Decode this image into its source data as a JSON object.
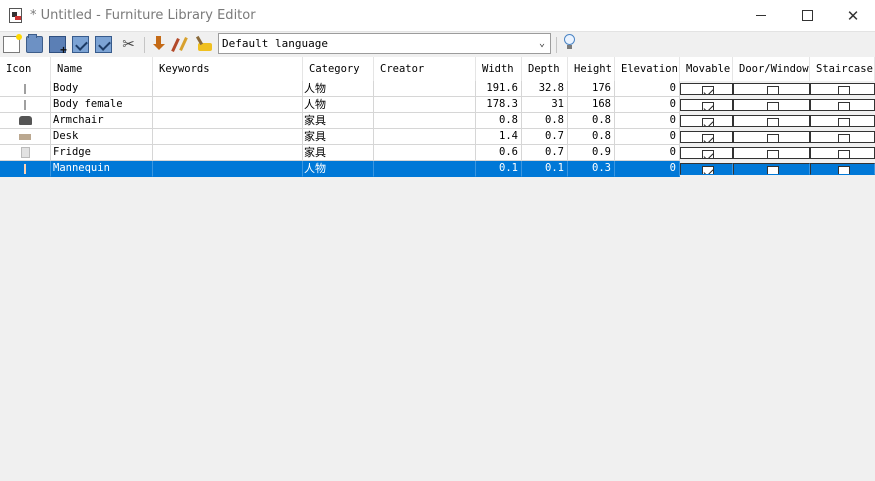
{
  "window": {
    "title": "* Untitled - Furniture Library Editor"
  },
  "toolbar": {
    "buttons": [
      "new-library",
      "open-library",
      "merge-library",
      "save-library",
      "save-as-library",
      "preferences",
      "import-furniture",
      "modify-furniture",
      "delete-furniture",
      "help"
    ],
    "language": "Default language"
  },
  "table": {
    "columns": [
      "Icon",
      "Name",
      "Keywords",
      "Category",
      "Creator",
      "Width",
      "Depth",
      "Height",
      "Elevation",
      "Movable",
      "Door/Window",
      "Staircase"
    ],
    "rows": [
      {
        "icon": "body",
        "name": "Body",
        "keywords": "",
        "category": "人物",
        "creator": "",
        "width": "191.6",
        "depth": "32.8",
        "height": "176",
        "elevation": "0",
        "movable": true,
        "door_window": false,
        "staircase": false
      },
      {
        "icon": "body",
        "name": "Body female",
        "keywords": "",
        "category": "人物",
        "creator": "",
        "width": "178.3",
        "depth": "31",
        "height": "168",
        "elevation": "0",
        "movable": true,
        "door_window": false,
        "staircase": false
      },
      {
        "icon": "armchair",
        "name": "Armchair",
        "keywords": "",
        "category": "家具",
        "creator": "",
        "width": "0.8",
        "depth": "0.8",
        "height": "0.8",
        "elevation": "0",
        "movable": true,
        "door_window": false,
        "staircase": false
      },
      {
        "icon": "desk",
        "name": "Desk",
        "keywords": "",
        "category": "家具",
        "creator": "",
        "width": "1.4",
        "depth": "0.7",
        "height": "0.8",
        "elevation": "0",
        "movable": true,
        "door_window": false,
        "staircase": false
      },
      {
        "icon": "fridge",
        "name": "Fridge",
        "keywords": "",
        "category": "家具",
        "creator": "",
        "width": "0.6",
        "depth": "0.7",
        "height": "0.9",
        "elevation": "0",
        "movable": true,
        "door_window": false,
        "staircase": false
      },
      {
        "icon": "mannequin",
        "name": "Mannequin",
        "keywords": "",
        "category": "人物",
        "creator": "",
        "width": "0.1",
        "depth": "0.1",
        "height": "0.3",
        "elevation": "0",
        "movable": true,
        "door_window": false,
        "staircase": false
      }
    ],
    "selected_row": 5
  },
  "colors": {
    "selection": "#0078d7",
    "background": "#f0f0f0",
    "grid": "#d6d6d6"
  }
}
